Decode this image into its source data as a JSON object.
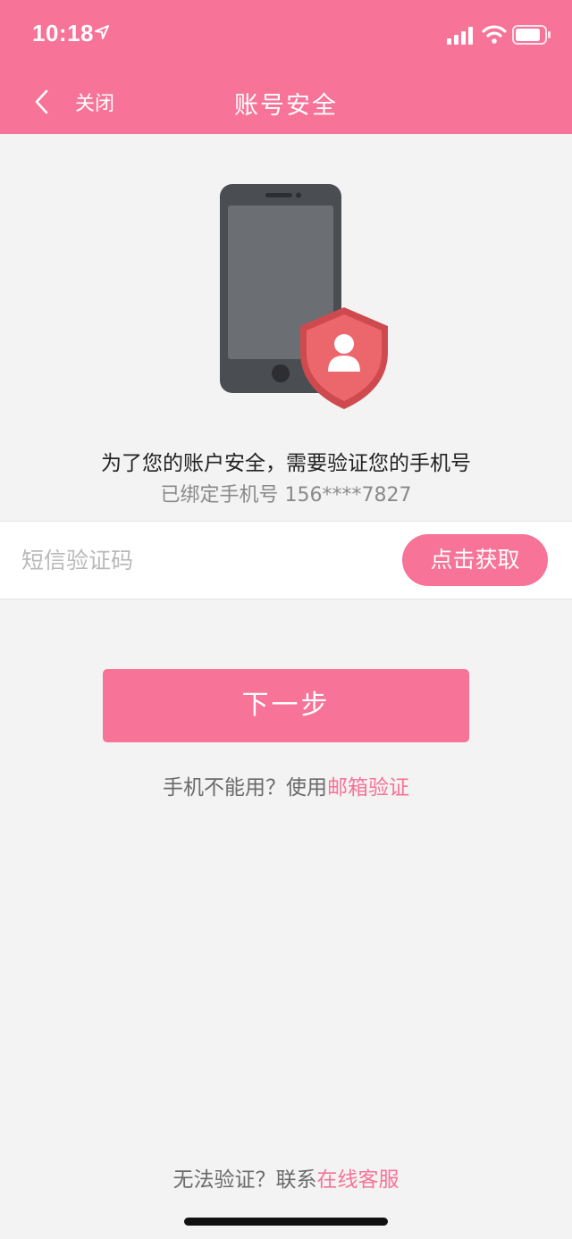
{
  "status_bar": {
    "time": "10:18",
    "icons": [
      "location-arrow-icon",
      "signal-icon",
      "wifi-icon",
      "battery-icon"
    ]
  },
  "nav": {
    "back_icon": "chevron-left-icon",
    "close_label": "关闭",
    "title": "账号安全"
  },
  "hero": {
    "icons": [
      "phone-icon",
      "shield-user-icon"
    ]
  },
  "verify": {
    "prompt": "为了您的账户安全，需要验证您的手机号",
    "bound_phone": "已绑定手机号 156****7827"
  },
  "code_field": {
    "value": "",
    "placeholder": "短信验证码",
    "get_code_label": "点击获取"
  },
  "next_button_label": "下一步",
  "alternative": {
    "text": "手机不能用？使用",
    "link": "邮箱验证"
  },
  "footer": {
    "text": "无法验证？联系",
    "link": "在线客服"
  },
  "colors": {
    "brand": "#f77398",
    "background": "#f3f3f3",
    "shield": "#e85a5e",
    "phone_body": "#4a4d52"
  }
}
